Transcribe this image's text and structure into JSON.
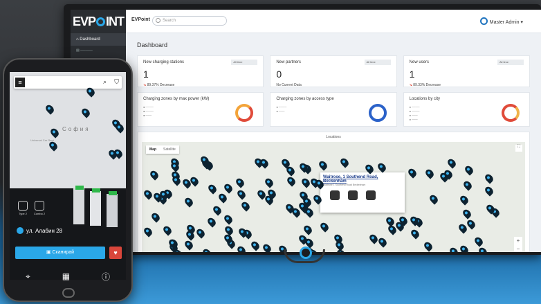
{
  "monitor": {
    "logo": "EVPOINT",
    "brand": "EVPoint",
    "search_placeholder": "Search",
    "user": "Master Admin",
    "sidebar": [
      {
        "label": "Dashboard"
      }
    ],
    "page_title": "Dashboard",
    "stats": [
      {
        "title": "New charging stations",
        "value": "1",
        "change": "89.37% Decrease",
        "range": "All time"
      },
      {
        "title": "New partners",
        "value": "0",
        "change": "No Current Data",
        "range": "All time"
      },
      {
        "title": "New users",
        "value": "1",
        "change": "89.33% Decrease",
        "range": "All time"
      }
    ],
    "charts": [
      {
        "title": "Charging zones by max power (kW)"
      },
      {
        "title": "Charging zones by access type"
      },
      {
        "title": "Locations by city"
      }
    ],
    "locations_title": "Locations",
    "map_tabs": [
      "Map",
      "Satellite"
    ],
    "popup": {
      "title": "Waitrose, 1 Southend Road, Beckenham",
      "subtitle": "Waitrose 1 Southend Road Beckenham",
      "connectors": [
        "CHAdeMO",
        "CCS 2",
        "Type 2"
      ]
    },
    "zoom_in": "+"
  },
  "phone": {
    "city": "София",
    "labels": [
      "Universal Car Rent"
    ],
    "connectors": [
      {
        "name": "Type 2"
      },
      {
        "name": "Combo 2"
      }
    ],
    "address": "ул. Алабин 28",
    "scan_label": "Сканирай",
    "heart": "♥"
  },
  "colors": {
    "accent": "#2aa7e8",
    "danger": "#d9463b",
    "sidebar": "#2a2d31"
  }
}
